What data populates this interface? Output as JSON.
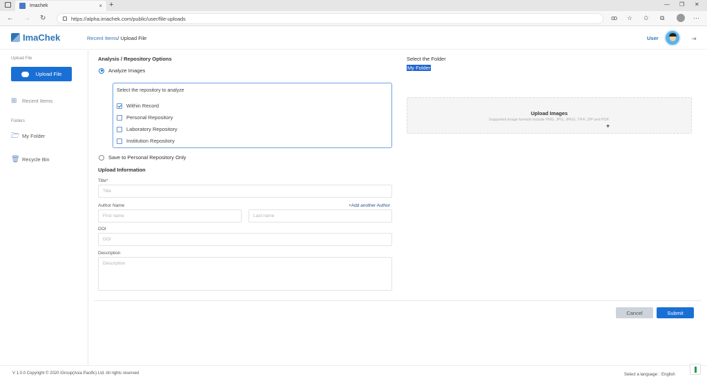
{
  "browser": {
    "tab_title": "Imachek",
    "tab_close": "×",
    "new_tab": "+",
    "url": "https://alpha.imachek.com/public/user/file-uploads",
    "minimize": "—",
    "restore": "❐",
    "close": "✕"
  },
  "header": {
    "logo": "ImaChek",
    "breadcrumb_link": "Recent Items",
    "breadcrumb_current": "/ Upload File",
    "user_label": "User"
  },
  "sidebar": {
    "upload_section_label": "Upload File",
    "upload_button": "Upload File",
    "recent_items": "Recent Items",
    "folders_label": "Folders",
    "my_folder": "My Folder",
    "recycle_bin": "Recycle Bin"
  },
  "analysis": {
    "title": "Analysis / Repository Options",
    "analyze_images": "Analyze Images",
    "repo_header": "Select the repository to analyze",
    "repos": [
      {
        "label": "Within Record",
        "checked": true
      },
      {
        "label": "Personal Repository",
        "checked": false
      },
      {
        "label": "Laboratory Repository",
        "checked": false
      },
      {
        "label": "Institution Repository",
        "checked": false
      }
    ],
    "save_personal": "Save to Personal Repository Only"
  },
  "upload_info": {
    "title": "Upload Information",
    "title_label": "Title",
    "title_required": "*",
    "title_placeholder": "Title",
    "author_label": "Author Name",
    "add_author": "Add another Author",
    "first_name_placeholder": "First name",
    "last_name_placeholder": "Last name",
    "doi_label": "DOI",
    "doi_placeholder": "DOI",
    "description_label": "Description",
    "description_placeholder": "Description"
  },
  "folder": {
    "title": "Select the Folder",
    "selected": "My Folder"
  },
  "dropzone": {
    "title": "Upload Images",
    "subtitle": "Supported image formats include PNG, JPG, JPEG, TIFF, ZIP and PDF."
  },
  "actions": {
    "cancel": "Cancel",
    "submit": "Submit"
  },
  "footer": {
    "copyright": "V 1.0.0 Copyright © 2020 iGroup(Asia Pacific) Ltd. All rights reserved",
    "language_label": "Select a language :",
    "language_value": "English"
  },
  "colors": {
    "primary": "#1a6fd4",
    "link": "#2e75b6",
    "cancel_bg": "#cdd3db"
  }
}
